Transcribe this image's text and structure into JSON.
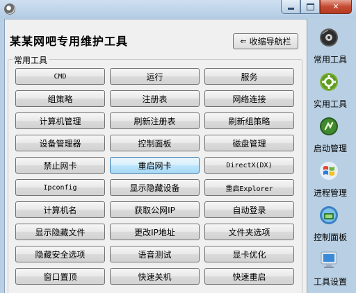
{
  "app": {
    "title": "某某网吧专用维护工具",
    "collapse_label": "收缩导航栏",
    "collapse_arrow": "⇐"
  },
  "group": {
    "label": "常用工具",
    "buttons": [
      "CMD",
      "运行",
      "服务",
      "组策略",
      "注册表",
      "网络连接",
      "计算机管理",
      "刷新注册表",
      "刷新组策略",
      "设备管理器",
      "控制面板",
      "磁盘管理",
      "禁止网卡",
      "重启网卡",
      "DirectX(DX)",
      "Ipconfig",
      "显示隐藏设备",
      "重启Explorer",
      "计算机名",
      "获取公网IP",
      "自动登录",
      "显示隐藏文件",
      "更改IP地址",
      "文件夹选项",
      "隐藏安全选项",
      "语音测试",
      "显卡优化",
      "窗口置顶",
      "快速关机",
      "快速重启"
    ]
  },
  "sidebar": {
    "items": [
      {
        "label": "常用工具",
        "icon": "disc-icon"
      },
      {
        "label": "实用工具",
        "icon": "gear-icon"
      },
      {
        "label": "启动管理",
        "icon": "startup-icon"
      },
      {
        "label": "进程管理",
        "icon": "windows-logo-icon"
      },
      {
        "label": "控制面板",
        "icon": "control-panel-icon"
      },
      {
        "label": "工具设置",
        "icon": "monitor-icon"
      }
    ]
  },
  "colors": {
    "accent_blue": "#3c7fb1",
    "close_red": "#c44c33"
  }
}
